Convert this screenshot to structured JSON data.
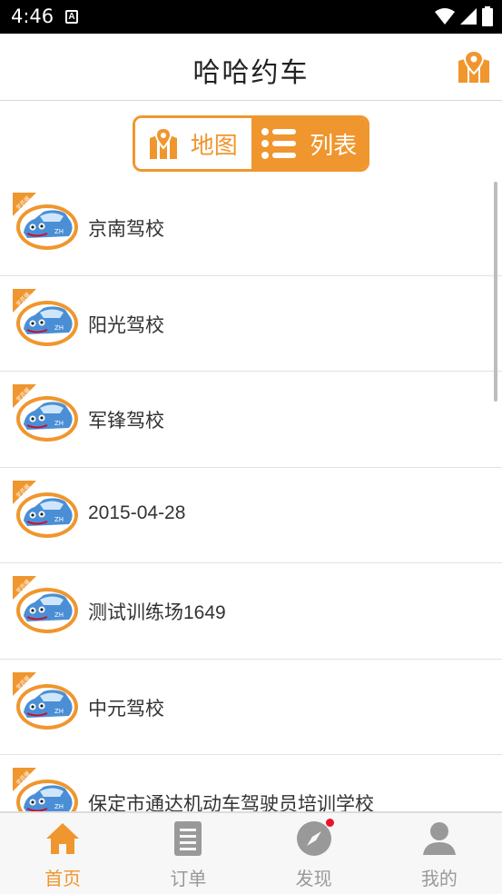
{
  "status_bar": {
    "time": "4:46",
    "sim_icon": "A"
  },
  "header": {
    "title": "哈哈约车",
    "map_icon": "map-pin-icon"
  },
  "toggle": {
    "map_label": "地图",
    "list_label": "列表",
    "selected": "list"
  },
  "list": {
    "badge_text": "学员端",
    "items": [
      {
        "name": "京南驾校"
      },
      {
        "name": "阳光驾校"
      },
      {
        "name": "军锋驾校"
      },
      {
        "name": "2015-04-28"
      },
      {
        "name": "测试训练场1649"
      },
      {
        "name": "中元驾校"
      },
      {
        "name": "保定市通达机动车驾驶员培训学校"
      }
    ]
  },
  "nav": {
    "home": {
      "label": "首页",
      "icon": "home-icon"
    },
    "orders": {
      "label": "订单",
      "icon": "document-icon"
    },
    "discover": {
      "label": "发现",
      "icon": "compass-icon"
    },
    "me": {
      "label": "我的",
      "icon": "person-icon"
    }
  },
  "colors": {
    "accent": "#f0962e",
    "notification": "#e8142a"
  }
}
